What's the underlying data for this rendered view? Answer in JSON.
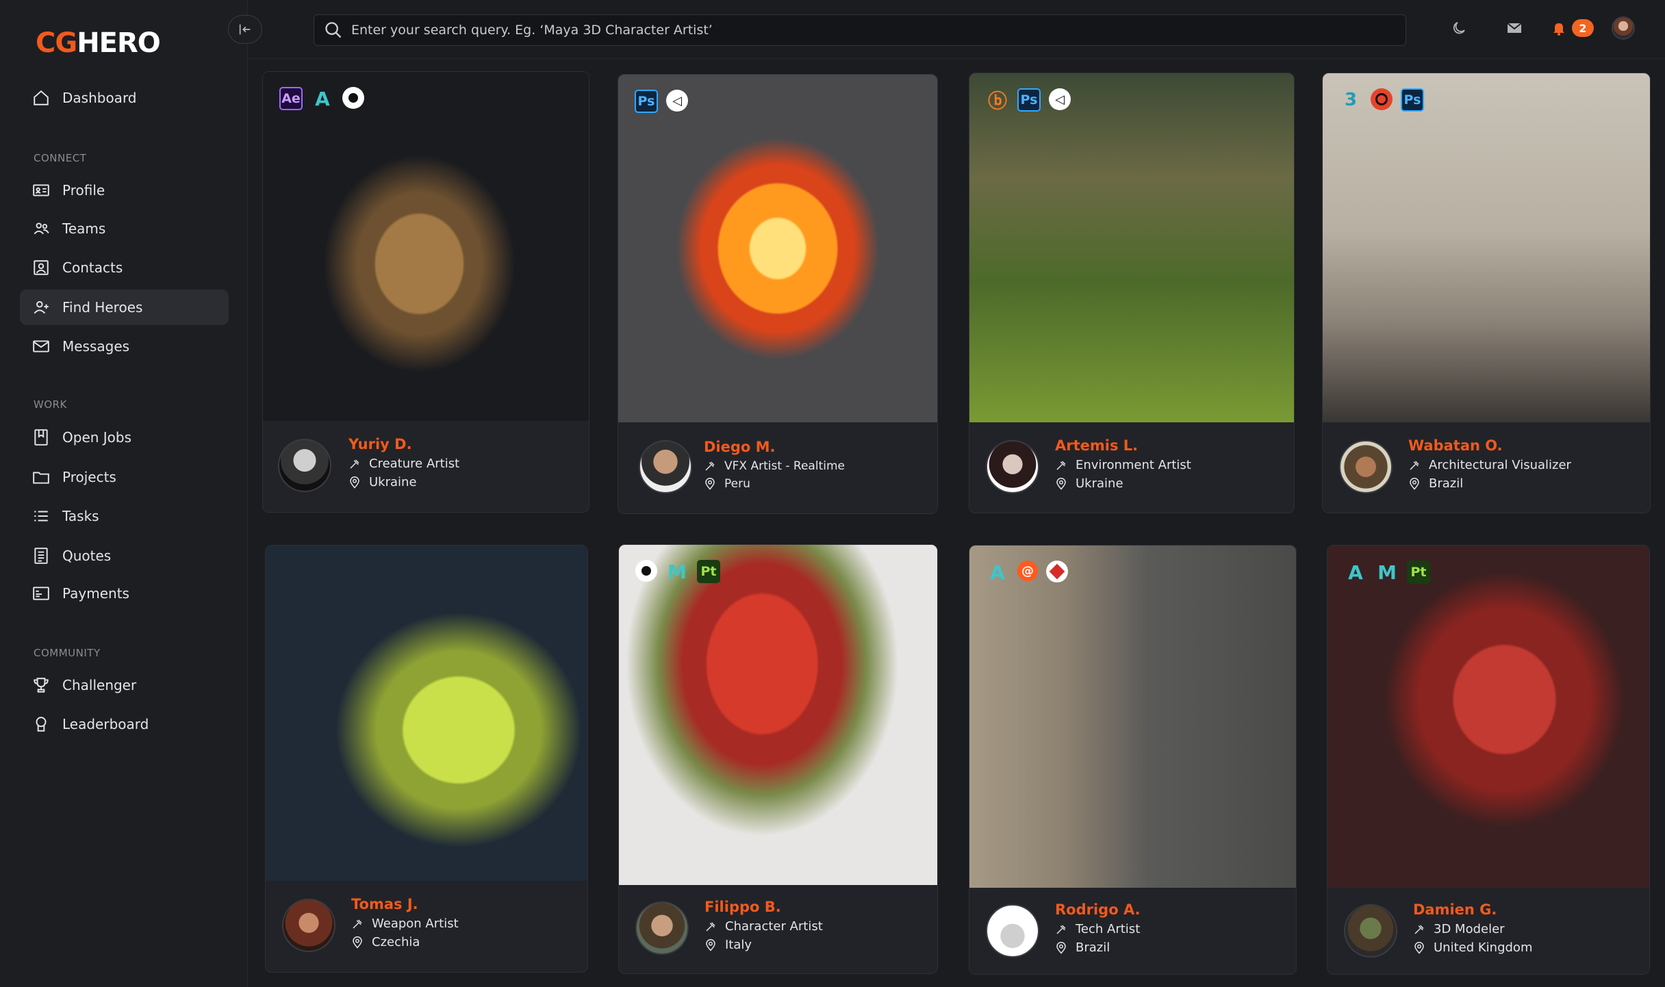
{
  "app": {
    "logo_first": "CG",
    "logo_second": "HERO"
  },
  "sidebar": {
    "dashboard": "Dashboard",
    "sections": {
      "connect": "CONNECT",
      "work": "WORK",
      "community": "COMMUNITY"
    },
    "items": {
      "profile": "Profile",
      "teams": "Teams",
      "contacts": "Contacts",
      "find_heroes": "Find Heroes",
      "messages": "Messages",
      "open_jobs": "Open Jobs",
      "projects": "Projects",
      "tasks": "Tasks",
      "quotes": "Quotes",
      "payments": "Payments",
      "challenger": "Challenger",
      "leaderboard": "Leaderboard"
    },
    "active_item": "Find Heroes"
  },
  "search": {
    "placeholder": "Enter your search query. Eg. ‘Maya 3D Character Artist’"
  },
  "topbar": {
    "notification_count": "2",
    "accent_color": "#f26522"
  },
  "artists": [
    {
      "name": "Yuriy D.",
      "role": "Creature Artist",
      "location": "Ukraine",
      "tools": [
        "Ae",
        "A",
        "circle"
      ],
      "artwork": "cheetah cub"
    },
    {
      "name": "Diego M.",
      "role": "VFX Artist - Realtime",
      "location": "Peru",
      "tools": [
        "Ps",
        "unity"
      ],
      "artwork": "fire explosion"
    },
    {
      "name": "Artemis L.",
      "role": "Environment Artist",
      "location": "Ukraine",
      "tools": [
        "blender",
        "Ps",
        "unity"
      ],
      "artwork": "forest"
    },
    {
      "name": "Wabatan O.",
      "role": "Architectural Visualizer",
      "location": "Brazil",
      "tools": [
        "3",
        "corona",
        "Ps"
      ],
      "artwork": "living room"
    },
    {
      "name": "Tomas J.",
      "role": "Weapon Artist",
      "location": "Czechia",
      "tools": [],
      "artwork": "green weapon"
    },
    {
      "name": "Filippo B.",
      "role": "Character Artist",
      "location": "Italy",
      "tools": [
        "circle",
        "M",
        "Pt"
      ],
      "artwork": "red haired warrior"
    },
    {
      "name": "Rodrigo A.",
      "role": "Tech Artist",
      "location": "Brazil",
      "tools": [
        "A",
        "houdini",
        "redcube"
      ],
      "artwork": "city street"
    },
    {
      "name": "Damien G.",
      "role": "3D Modeler",
      "location": "United Kingdom",
      "tools": [
        "A",
        "M",
        "Pt"
      ],
      "artwork": "red dinosaur"
    }
  ]
}
